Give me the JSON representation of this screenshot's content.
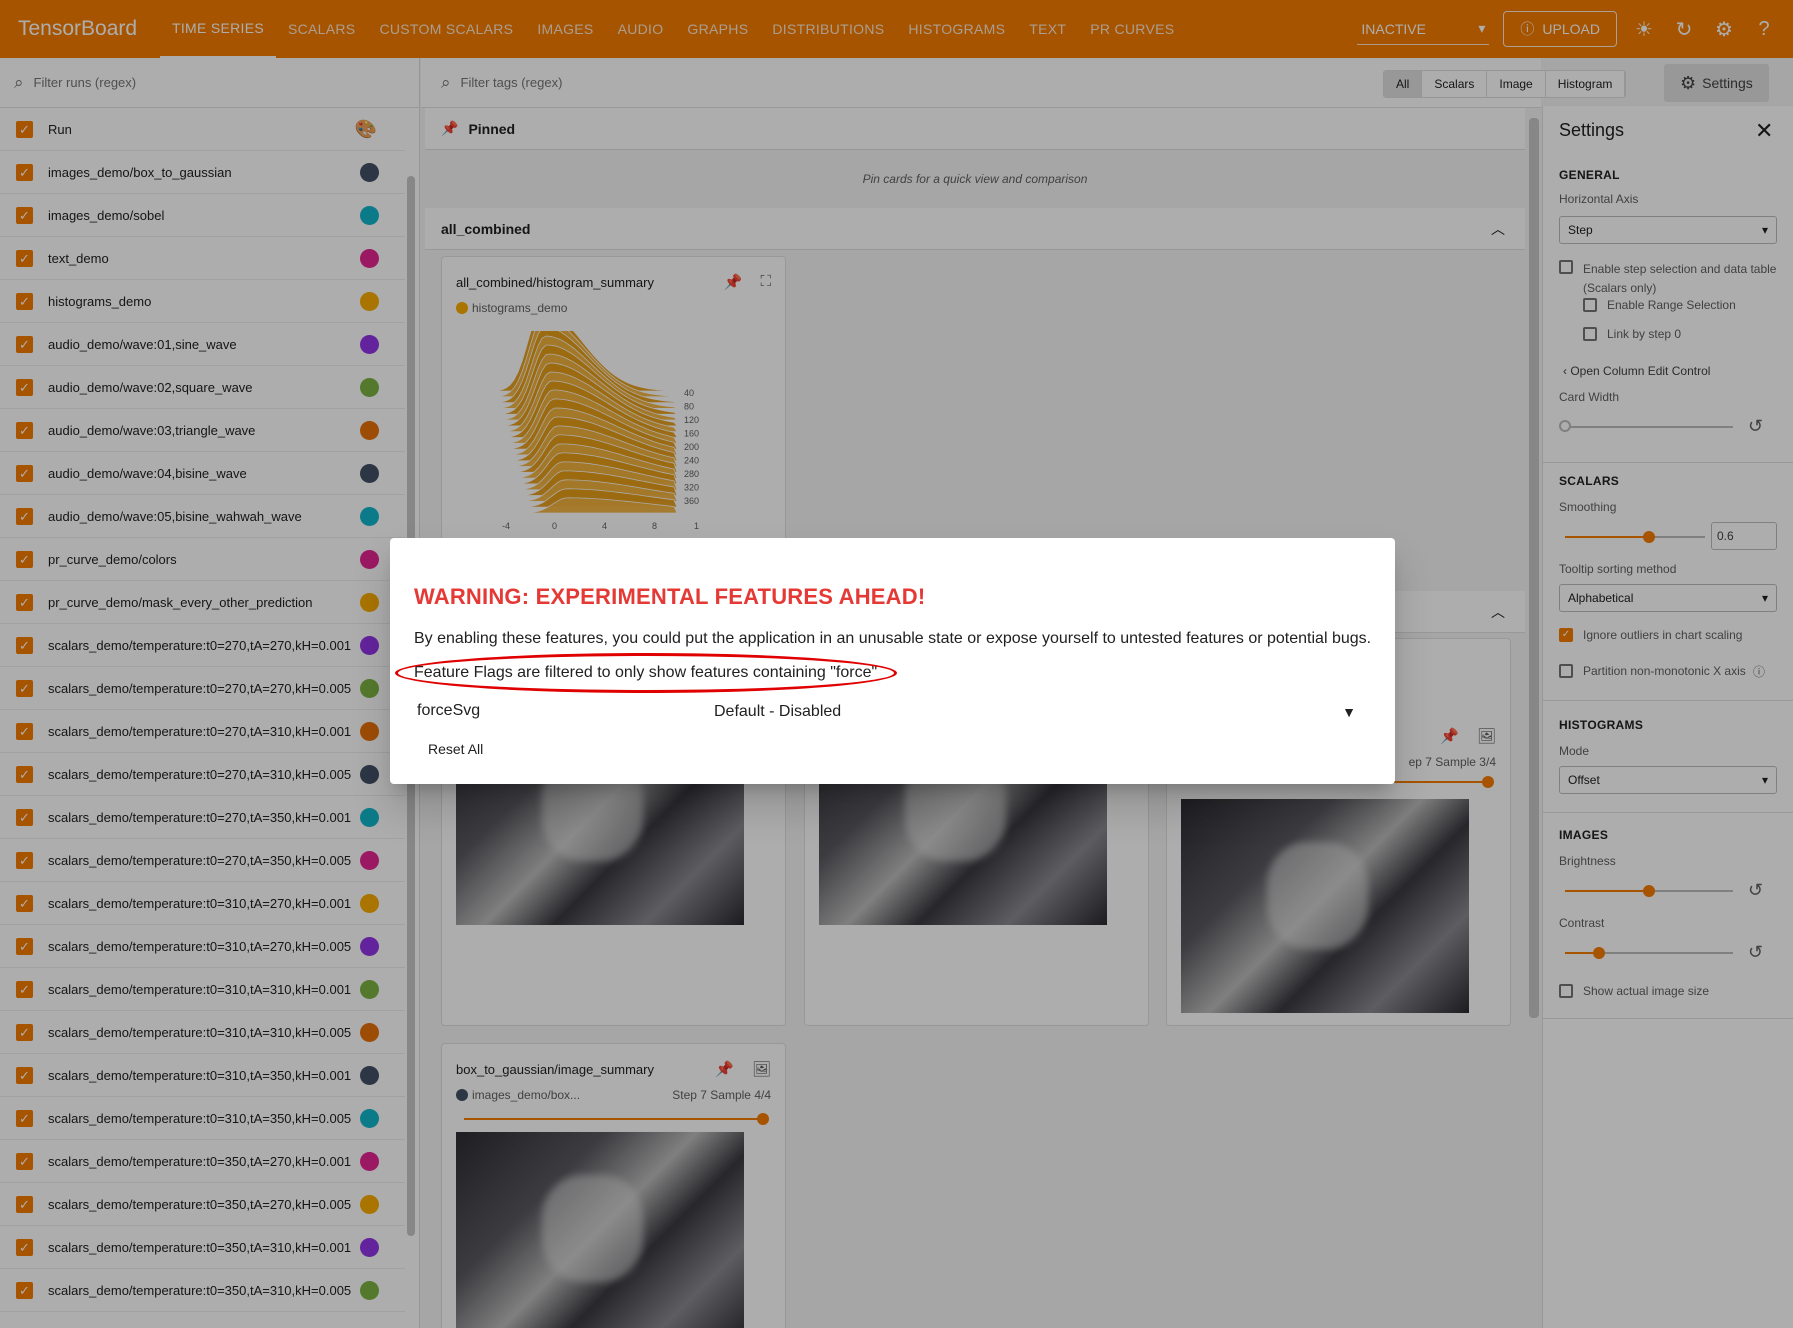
{
  "app": {
    "brand": "TensorBoard",
    "nav_tabs": [
      {
        "label": "TIME SERIES",
        "active": true
      },
      {
        "label": "SCALARS"
      },
      {
        "label": "CUSTOM SCALARS"
      },
      {
        "label": "IMAGES"
      },
      {
        "label": "AUDIO"
      },
      {
        "label": "GRAPHS"
      },
      {
        "label": "DISTRIBUTIONS"
      },
      {
        "label": "HISTOGRAMS"
      },
      {
        "label": "TEXT"
      },
      {
        "label": "PR CURVES"
      }
    ],
    "reload_status": "INACTIVE",
    "upload_label": "UPLOAD",
    "accent": "#f57c00"
  },
  "runs": {
    "filter_placeholder": "Filter runs (regex)",
    "header_label": "Run",
    "items": [
      {
        "name": "images_demo/box_to_gaussian",
        "color": "#425066"
      },
      {
        "name": "images_demo/sobel",
        "color": "#12b5cb"
      },
      {
        "name": "text_demo",
        "color": "#e52592"
      },
      {
        "name": "histograms_demo",
        "color": "#f9ab00"
      },
      {
        "name": "audio_demo/wave:01,sine_wave",
        "color": "#9334e6"
      },
      {
        "name": "audio_demo/wave:02,square_wave",
        "color": "#7cb342"
      },
      {
        "name": "audio_demo/wave:03,triangle_wave",
        "color": "#e8710a"
      },
      {
        "name": "audio_demo/wave:04,bisine_wave",
        "color": "#425066"
      },
      {
        "name": "audio_demo/wave:05,bisine_wahwah_wave",
        "color": "#12b5cb"
      },
      {
        "name": "pr_curve_demo/colors",
        "color": "#e52592"
      },
      {
        "name": "pr_curve_demo/mask_every_other_prediction",
        "color": "#f9ab00"
      },
      {
        "name": "scalars_demo/temperature:t0=270,tA=270,kH=0.001",
        "color": "#9334e6"
      },
      {
        "name": "scalars_demo/temperature:t0=270,tA=270,kH=0.005",
        "color": "#7cb342"
      },
      {
        "name": "scalars_demo/temperature:t0=270,tA=310,kH=0.001",
        "color": "#e8710a"
      },
      {
        "name": "scalars_demo/temperature:t0=270,tA=310,kH=0.005",
        "color": "#425066"
      },
      {
        "name": "scalars_demo/temperature:t0=270,tA=350,kH=0.001",
        "color": "#12b5cb"
      },
      {
        "name": "scalars_demo/temperature:t0=270,tA=350,kH=0.005",
        "color": "#e52592"
      },
      {
        "name": "scalars_demo/temperature:t0=310,tA=270,kH=0.001",
        "color": "#f9ab00"
      },
      {
        "name": "scalars_demo/temperature:t0=310,tA=270,kH=0.005",
        "color": "#9334e6"
      },
      {
        "name": "scalars_demo/temperature:t0=310,tA=310,kH=0.001",
        "color": "#7cb342"
      },
      {
        "name": "scalars_demo/temperature:t0=310,tA=310,kH=0.005",
        "color": "#e8710a"
      },
      {
        "name": "scalars_demo/temperature:t0=310,tA=350,kH=0.001",
        "color": "#425066"
      },
      {
        "name": "scalars_demo/temperature:t0=310,tA=350,kH=0.005",
        "color": "#12b5cb"
      },
      {
        "name": "scalars_demo/temperature:t0=350,tA=270,kH=0.001",
        "color": "#e52592"
      },
      {
        "name": "scalars_demo/temperature:t0=350,tA=270,kH=0.005",
        "color": "#f9ab00"
      },
      {
        "name": "scalars_demo/temperature:t0=350,tA=310,kH=0.001",
        "color": "#9334e6"
      },
      {
        "name": "scalars_demo/temperature:t0=350,tA=310,kH=0.005",
        "color": "#7cb342"
      }
    ]
  },
  "main": {
    "tag_filter_placeholder": "Filter tags (regex)",
    "tag_types": [
      "All",
      "Scalars",
      "Image",
      "Histogram"
    ],
    "settings_label": "Settings",
    "pinned_label": "Pinned",
    "pinned_hint": "Pin cards for a quick view and comparison",
    "group_label": "all_combined",
    "histogram_card": {
      "title": "all_combined/histogram_summary",
      "run": "histograms_demo",
      "y_ticks": [
        "40",
        "80",
        "120",
        "160",
        "200",
        "240",
        "280",
        "320",
        "360"
      ],
      "x_ticks": [
        "-4",
        "0",
        "4",
        "8",
        "1"
      ]
    },
    "image_card_right": {
      "step_label": "ep 7  Sample 3/4"
    },
    "image_card_bottom": {
      "title": "box_to_gaussian/image_summary",
      "run": "images_demo/box...",
      "step_label": "Step 7  Sample 4/4"
    }
  },
  "settings": {
    "title": "Settings",
    "general_heading": "GENERAL",
    "horizontal_axis_label": "Horizontal Axis",
    "horizontal_axis_value": "Step",
    "step_selection_label_1": "Enable step selection and data table",
    "step_selection_label_2": "(Scalars only)",
    "range_selection_label": "Enable Range Selection",
    "link_step_label": "Link by step 0",
    "column_edit_label": "Open Column Edit Control",
    "card_width_label": "Card Width",
    "card_width_level": 0,
    "scalars_heading": "SCALARS",
    "smoothing_label": "Smoothing",
    "smoothing_value": "0.6",
    "tooltip_sort_label": "Tooltip sorting method",
    "tooltip_sort_value": "Alphabetical",
    "ignore_outliers_label": "Ignore outliers in chart scaling",
    "partition_label": "Partition non-monotonic X axis",
    "histograms_heading": "HISTOGRAMS",
    "mode_label": "Mode",
    "mode_value": "Offset",
    "images_heading": "IMAGES",
    "brightness_label": "Brightness",
    "brightness_level": 0.5,
    "contrast_label": "Contrast",
    "contrast_level": 0.2,
    "actual_size_label": "Show actual image size"
  },
  "dialog": {
    "title": "WARNING: EXPERIMENTAL FEATURES AHEAD!",
    "body": "By enabling these features, you could put the application in an unusable state or expose yourself to untested features or potential bugs.",
    "filter_note": "Feature Flags are filtered to only show features containing \"force\"",
    "flag_name": "forceSvg",
    "flag_value": "Default - Disabled",
    "reset_label": "Reset All",
    "warning_color": "#e53935"
  }
}
